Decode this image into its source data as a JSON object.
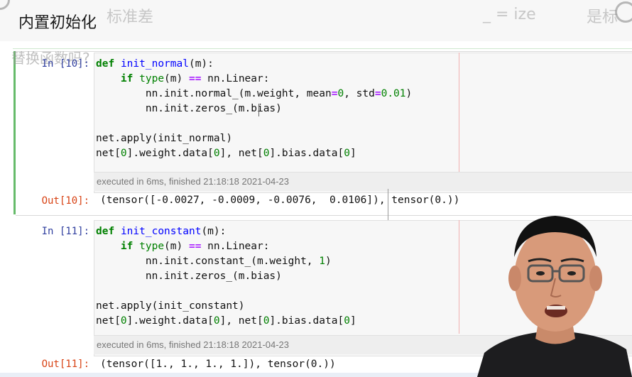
{
  "slide": {
    "title": "内置初始化",
    "ghost_left": "标准差",
    "ghost_mid": "_ = ize",
    "ghost_right": "是标",
    "ghost_sub": "替换函数吗?"
  },
  "cells": [
    {
      "in_prompt": "In [10]:",
      "code_lines": [
        "def init_normal(m):",
        "    if type(m) == nn.Linear:",
        "        nn.init.normal_(m.weight, mean=0, std=0.01)",
        "        nn.init.zeros_(m.bias)",
        "",
        "net.apply(init_normal)",
        "net[0].weight.data[0], net[0].bias.data[0]"
      ],
      "exec_info": "executed in 6ms, finished 21:18:18 2021-04-23",
      "out_prompt": "Out[10]:",
      "output": "(tensor([-0.0027, -0.0009, -0.0076,  0.0106]), tensor(0.))"
    },
    {
      "in_prompt": "In [11]:",
      "code_lines": [
        "def init_constant(m):",
        "    if type(m) == nn.Linear:",
        "        nn.init.constant_(m.weight, 1)",
        "        nn.init.zeros_(m.bias)",
        "",
        "net.apply(init_constant)",
        "net[0].weight.data[0], net[0].bias.data[0]"
      ],
      "exec_info": "executed in 6ms, finished 21:18:18 2021-04-23",
      "out_prompt": "Out[11]:",
      "output": "(tensor([1., 1., 1., 1.]), tensor(0.))"
    }
  ],
  "icons": {
    "presenter": "person-video-icon"
  },
  "colors": {
    "selected_cell": "#66bb6a",
    "in_prompt": "#303f9f",
    "out_prompt": "#d84315",
    "keyword": "#008000",
    "function_name": "#0000ff"
  }
}
